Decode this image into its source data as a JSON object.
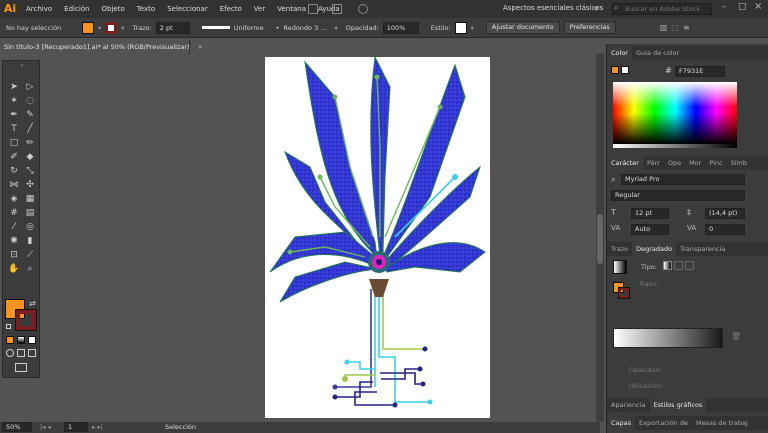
{
  "app": {
    "logo": "Ai"
  },
  "menu": [
    "Archivo",
    "Edición",
    "Objeto",
    "Texto",
    "Seleccionar",
    "Efecto",
    "Ver",
    "Ventana",
    "Ayuda"
  ],
  "workspace": "Aspectos esenciales clásicos",
  "search": {
    "placeholder": "Buscar en Adobe Stock"
  },
  "control": {
    "selection": "No hay selección",
    "stroke_label": "Trazo:",
    "stroke_value": "2 pt",
    "profile": "Uniforme",
    "brush": "Redondo 3 ...",
    "opacity_label": "Opacidad:",
    "opacity_value": "100%",
    "style_label": "Estilo:",
    "arrange_button": "Ajustar documento",
    "prefs_button": "Preferencias",
    "fill_color": "#f7931e"
  },
  "document": {
    "tab_title": "Sin título-3 [Recuperado1].ai* al 50% (RGB/Previsualizar)"
  },
  "status": {
    "zoom": "50%",
    "page": "1",
    "tool": "Selección"
  },
  "panels": {
    "color": {
      "tabs": [
        "Color",
        "Guía de color"
      ],
      "hex": "F7931E"
    },
    "character": {
      "tabs": [
        "Carácter",
        "Párr",
        "Ope",
        "Mor",
        "Pinc",
        "Símb"
      ],
      "font": "Myriad Pro",
      "style": "Regular",
      "size": "12 pt",
      "leading": "(14,4 pt)",
      "kerning": "Auto",
      "tracking": "0"
    },
    "gradient": {
      "tabs": [
        "Trazo",
        "Degradado",
        "Transparencia"
      ],
      "type_label": "Tipo:",
      "stroke_label": "Trazo:",
      "opacity_label": "Opacidad:",
      "location_label": "Ubicación:"
    },
    "bottom_tabs_1": [
      "Apariencia",
      "Estilos gráficos"
    ],
    "bottom_tabs_2": [
      "Capas",
      "Exportación de",
      "Mesas de trabaj"
    ]
  }
}
